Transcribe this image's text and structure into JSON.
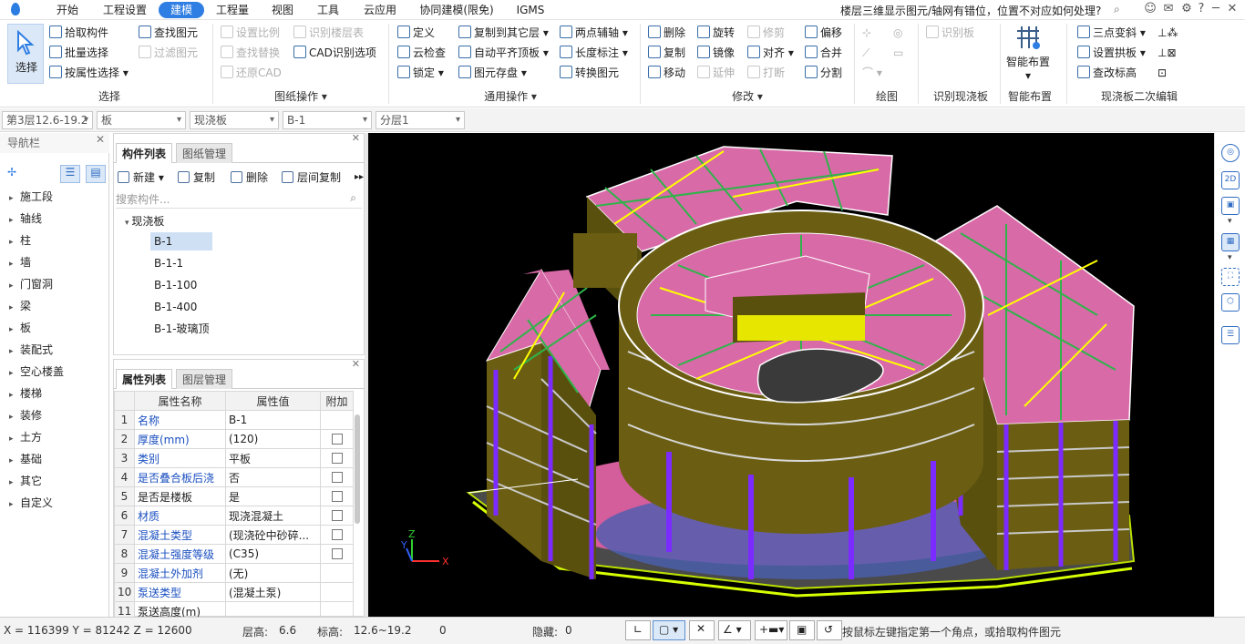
{
  "menubar": {
    "tabs": [
      "开始",
      "工程设置",
      "建模",
      "工程量",
      "视图",
      "工具",
      "云应用",
      "协同建模(限免)",
      "IGMS"
    ],
    "active_tab": "建模",
    "question": "楼层三维显示图元/轴网有错位，位置不对应如何处理?",
    "help": "?"
  },
  "ribbon": {
    "select": {
      "big": "选择",
      "items": [
        "拾取构件",
        "批量选择",
        "按属性选择"
      ],
      "label": "选择"
    },
    "drawing_ops": {
      "items": [
        "查找图元",
        "设置比例",
        "识别楼层表",
        "过滤图元",
        "查找替换",
        "CAD识别选项",
        "还原CAD"
      ],
      "label": "图纸操作"
    },
    "common_ops": {
      "items": [
        "定义",
        "复制到其它层",
        "两点辅轴",
        "云检查",
        "自动平齐顶板",
        "长度标注",
        "锁定",
        "图元存盘",
        "转换图元"
      ],
      "label": "通用操作"
    },
    "modify": {
      "items": [
        "删除",
        "旋转",
        "修剪",
        "偏移",
        "复制",
        "镜像",
        "对齐",
        "合并",
        "移动",
        "延伸",
        "打断",
        "分割"
      ],
      "label": "修改"
    },
    "draw": {
      "label": "绘图"
    },
    "recognize": {
      "item": "识别板",
      "label": "识别现浇板"
    },
    "smart": {
      "big": "智能布置",
      "label": "智能布置"
    },
    "secondary": {
      "items": [
        "三点变斜",
        "设置拱板",
        "查改标高"
      ],
      "label": "现浇板二次编辑"
    }
  },
  "filterbar": {
    "floor": "第3层12.6-19.2",
    "type": "板",
    "subtype": "现浇板",
    "component": "B-1",
    "layer": "分层1"
  },
  "nav": {
    "title": "导航栏",
    "items": [
      "施工段",
      "轴线",
      "柱",
      "墙",
      "门窗洞",
      "梁",
      "板",
      "装配式",
      "空心楼盖",
      "楼梯",
      "装修",
      "土方",
      "基础",
      "其它",
      "自定义"
    ]
  },
  "components": {
    "tabs": [
      "构件列表",
      "图纸管理"
    ],
    "toolbar": [
      "新建",
      "复制",
      "删除",
      "层间复制"
    ],
    "search_placeholder": "搜索构件...",
    "tree_root": "现浇板",
    "tree_items": [
      "B-1",
      "B-1-1",
      "B-1-100",
      "B-1-400",
      "B-1-玻璃顶"
    ],
    "selected": "B-1"
  },
  "properties": {
    "tabs": [
      "属性列表",
      "图层管理"
    ],
    "headers": [
      "属性名称",
      "属性值",
      "附加"
    ],
    "rows": [
      {
        "num": "1",
        "name": "名称",
        "value": "B-1",
        "blue": true,
        "cb": false
      },
      {
        "num": "2",
        "name": "厚度(mm)",
        "value": "(120)",
        "blue": true,
        "cb": true
      },
      {
        "num": "3",
        "name": "类别",
        "value": "平板",
        "blue": true,
        "cb": true
      },
      {
        "num": "4",
        "name": "是否叠合板后浇",
        "value": "否",
        "blue": true,
        "cb": true
      },
      {
        "num": "5",
        "name": "是否是楼板",
        "value": "是",
        "blue": false,
        "cb": true
      },
      {
        "num": "6",
        "name": "材质",
        "value": "现浇混凝土",
        "blue": true,
        "cb": true
      },
      {
        "num": "7",
        "name": "混凝土类型",
        "value": "(现浇砼中砂碎...",
        "blue": true,
        "cb": true
      },
      {
        "num": "8",
        "name": "混凝土强度等级",
        "value": "(C35)",
        "blue": true,
        "cb": true
      },
      {
        "num": "9",
        "name": "混凝土外加剂",
        "value": "(无)",
        "blue": true,
        "cb": false
      },
      {
        "num": "10",
        "name": "泵送类型",
        "value": "(混凝土泵)",
        "blue": true,
        "cb": false
      },
      {
        "num": "11",
        "name": "泵送高度(m)",
        "value": "",
        "blue": false,
        "cb": false
      }
    ]
  },
  "status": {
    "coords": "X = 116399 Y = 81242 Z = 12600",
    "floor_height_label": "层高:",
    "floor_height": "6.6",
    "elevation_label": "标高:",
    "elevation": "12.6~19.2",
    "zero": "0",
    "hidden_label": "隐藏:",
    "hidden": "0",
    "hint": "按鼠标左键指定第一个角点，或拾取构件图元"
  },
  "colors": {
    "accent": "#2f7ee3",
    "slab": "#d96aa8",
    "wall": "#7a6a10",
    "column": "#6a22d6",
    "beam": "#2fb34a"
  }
}
